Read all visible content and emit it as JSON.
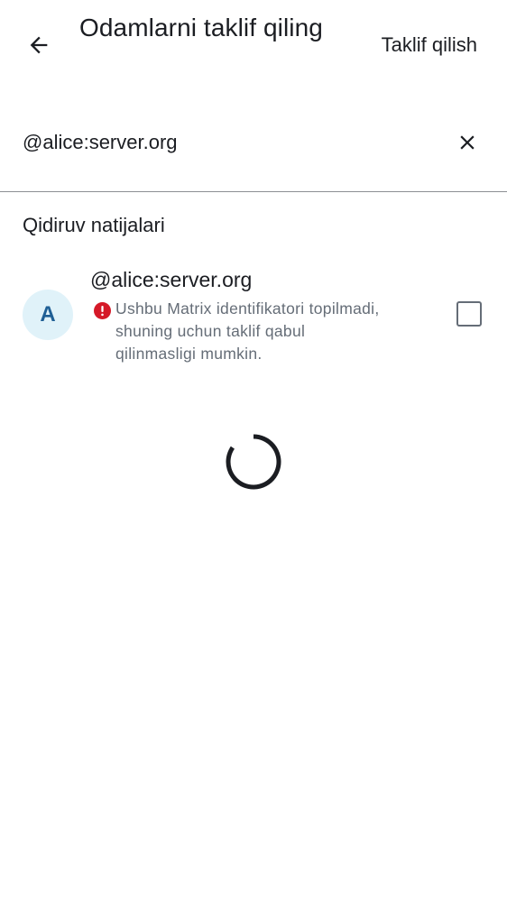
{
  "header": {
    "title": "Odamlarni taklif qiling",
    "action_label": "Taklif qilish",
    "back_icon": "arrow-left-icon"
  },
  "search": {
    "value": "@alice:server.org",
    "clear_icon": "close-icon"
  },
  "results": {
    "section_title": "Qidiruv natijalari",
    "items": [
      {
        "avatar_initial": "A",
        "name": "@alice:server.org",
        "warning": "Ushbu Matrix identifikatori topilmadi, shuning uchun taklif qabul qilinmasligi mumkin.",
        "warning_icon": "error-icon",
        "checked": false
      }
    ]
  },
  "colors": {
    "text_primary": "#1b1d22",
    "text_secondary": "#656d77",
    "avatar_bg": "#e0f2f9",
    "avatar_fg": "#1f5f95",
    "error": "#d51928"
  }
}
